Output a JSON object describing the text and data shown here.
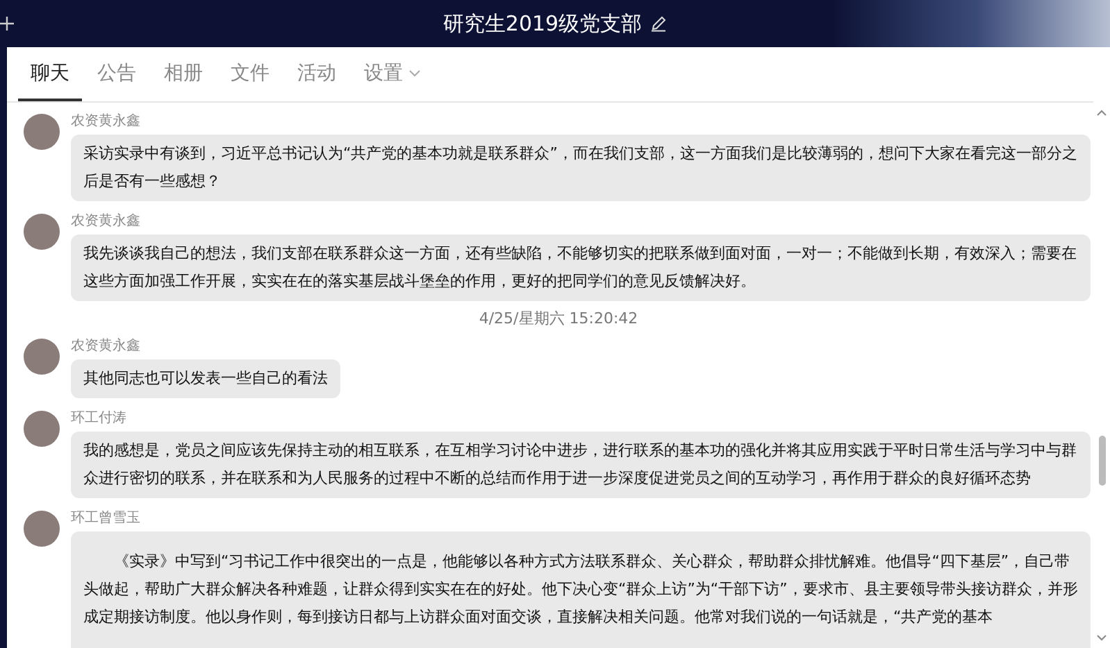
{
  "window": {
    "title": "研究生2019级党支部"
  },
  "tabs": [
    {
      "label": "聊天",
      "selected": true
    },
    {
      "label": "公告",
      "selected": false
    },
    {
      "label": "相册",
      "selected": false
    },
    {
      "label": "文件",
      "selected": false
    },
    {
      "label": "活动",
      "selected": false
    },
    {
      "label": "设置",
      "selected": false,
      "dropdown": true
    }
  ],
  "messages": [
    {
      "kind": "message",
      "sender": "农资黄永鑫",
      "text": "采访实录中有谈到，习近平总书记认为“共产党的基本功就是联系群众”，而在我们支部，这一方面我们是比较薄弱的，想问下大家在看完这一部分之后是否有一些感想？"
    },
    {
      "kind": "message",
      "sender": "农资黄永鑫",
      "text": "我先谈谈我自己的想法，我们支部在联系群众这一方面，还有些缺陷，不能够切实的把联系做到面对面，一对一；不能做到长期，有效深入；需要在这些方面加强工作开展，实实在在的落实基层战斗堡垒的作用，更好的把同学们的意见反馈解决好。"
    },
    {
      "kind": "time",
      "text": "4/25/星期六 15:20:42"
    },
    {
      "kind": "message",
      "sender": "农资黄永鑫",
      "text": "其他同志也可以发表一些自己的看法"
    },
    {
      "kind": "message",
      "sender": "环工付涛",
      "text": "我的感想是，党员之间应该先保持主动的相互联系，在互相学习讨论中进步，进行联系的基本功的强化并将其应用实践于平时日常生活与学习中与群众进行密切的联系，并在联系和为人民服务的过程中不断的总结而作用于进一步深度促进党员之间的互动学习，再作用于群众的良好循环态势"
    },
    {
      "kind": "message",
      "sender": "环工曾雪玉",
      "text": "《实录》中写到“习书记工作中很突出的一点是，他能够以各种方式方法联系群众、关心群众，帮助群众排忧解难。他倡导“四下基层”，自己带头做起，帮助广大群众解决各种难题，让群众得到实实在在的好处。他下决心变“群众上访”为“干部下访”，要求市、县主要领导带头接访群众，并形成定期接访制度。他以身作则，每到接访日都与上访群众面对面交谈，直接解决相关问题。他常对我们说的一句话就是，“共产党的基本"
    }
  ]
}
